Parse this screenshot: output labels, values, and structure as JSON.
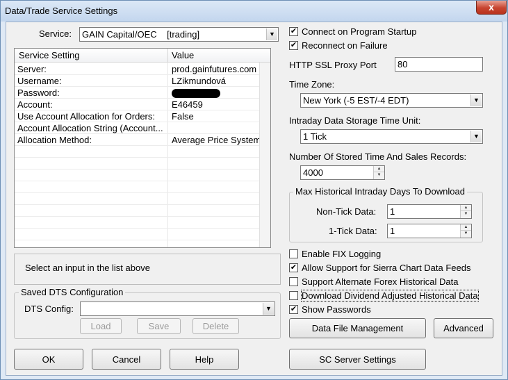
{
  "window": {
    "title": "Data/Trade Service Settings",
    "close_glyph": "x"
  },
  "service": {
    "label": "Service:",
    "value": "GAIN Capital/OEC    [trading]"
  },
  "settings_list": {
    "col_setting": "Service Setting",
    "col_value": "Value",
    "rows": [
      {
        "setting": "Server:",
        "value": "prod.gainfutures.com"
      },
      {
        "setting": "Username:",
        "value": "LZikmundová"
      },
      {
        "setting": "Password:",
        "value": "",
        "masked": true
      },
      {
        "setting": "Account:",
        "value": "E46459"
      },
      {
        "setting": "Use Account Allocation for Orders:",
        "value": "False"
      },
      {
        "setting": "Account Allocation String (Account...",
        "value": ""
      },
      {
        "setting": "Allocation Method:",
        "value": "Average Price System"
      }
    ]
  },
  "info_text": "Select an input in the list above",
  "saved_dts": {
    "group_title": "Saved DTS Configuration",
    "config_label": "DTS Config:",
    "config_value": "",
    "load": "Load",
    "save": "Save",
    "delete": "Delete"
  },
  "bottom_buttons": {
    "ok": "OK",
    "cancel": "Cancel",
    "help": "Help",
    "sc_server": "SC Server Settings"
  },
  "connect_on_startup": {
    "label": "Connect on Program Startup",
    "checked": true
  },
  "reconnect_on_failure": {
    "label": "Reconnect on Failure",
    "checked": true
  },
  "proxy_port": {
    "label": "HTTP SSL Proxy Port",
    "value": "80"
  },
  "time_zone": {
    "label": "Time Zone:",
    "value": "New York (-5 EST/-4 EDT)"
  },
  "storage_unit": {
    "label": "Intraday Data Storage Time Unit:",
    "value": "1 Tick"
  },
  "stored_records": {
    "label": "Number Of Stored Time And Sales Records:",
    "value": "4000"
  },
  "max_hist": {
    "group_title": "Max Historical Intraday Days To Download",
    "non_tick_label": "Non-Tick Data:",
    "non_tick_value": "1",
    "one_tick_label": "1-Tick Data:",
    "one_tick_value": "1"
  },
  "checkboxes": [
    {
      "label": "Enable FIX Logging",
      "checked": false
    },
    {
      "label": "Allow Support for Sierra Chart Data Feeds",
      "checked": true
    },
    {
      "label": "Support Alternate Forex Historical Data",
      "checked": false
    },
    {
      "label": "Download Dividend Adjusted Historical Data",
      "checked": false
    },
    {
      "label": "Show Passwords",
      "checked": true
    }
  ],
  "data_file_management": "Data File Management",
  "advanced": "Advanced",
  "check_glyph": "✔",
  "arrow_glyph": "▼",
  "spin_up": "▲",
  "spin_down": "▼"
}
